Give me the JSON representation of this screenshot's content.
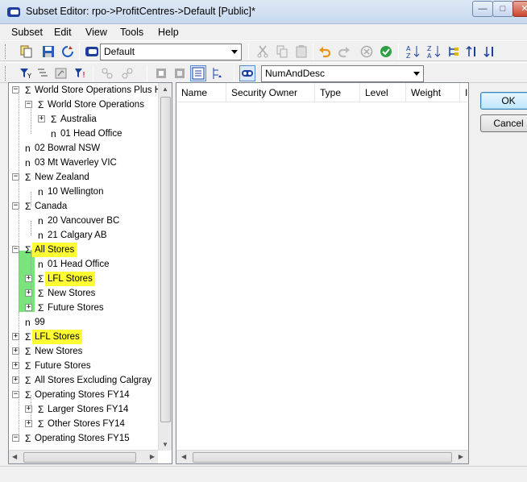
{
  "window": {
    "title": "Subset Editor:  rpo->ProfitCentres->Default  [Public]*",
    "minimize": "—",
    "maximize": "□",
    "close": "✕"
  },
  "menu": [
    "Subset",
    "Edit",
    "View",
    "Tools",
    "Help"
  ],
  "toolbar1": {
    "subset_name": "Default"
  },
  "toolbar2": {
    "alias_value": "NumAndDesc"
  },
  "tree": {
    "rows": [
      {
        "label": "World Store Operations Plus HC",
        "icon": "Σ",
        "exp": "−",
        "highlight": false
      },
      {
        "label": "World Store Operations",
        "icon": "Σ",
        "exp": "−",
        "highlight": false
      },
      {
        "label": "Australia",
        "icon": "Σ",
        "exp": "+",
        "highlight": false
      },
      {
        "label": "01 Head Office",
        "icon": "n",
        "exp": "",
        "highlight": false
      },
      {
        "label": "02 Bowral NSW",
        "icon": "n",
        "exp": "",
        "highlight": false
      },
      {
        "label": "03 Mt Waverley VIC",
        "icon": "n",
        "exp": "",
        "highlight": false
      },
      {
        "label": "New Zealand",
        "icon": "Σ",
        "exp": "−",
        "highlight": false
      },
      {
        "label": "10 Wellington",
        "icon": "n",
        "exp": "",
        "highlight": false
      },
      {
        "label": "Canada",
        "icon": "Σ",
        "exp": "−",
        "highlight": false
      },
      {
        "label": "20 Vancouver BC",
        "icon": "n",
        "exp": "",
        "highlight": false
      },
      {
        "label": "21 Calgary AB",
        "icon": "n",
        "exp": "",
        "highlight": false
      },
      {
        "label": "All Stores",
        "icon": "Σ",
        "exp": "−",
        "highlight": true
      },
      {
        "label": "01 Head Office",
        "icon": "n",
        "exp": "",
        "highlight": false
      },
      {
        "label": "LFL Stores",
        "icon": "Σ",
        "exp": "+",
        "highlight": true
      },
      {
        "label": "New Stores",
        "icon": "Σ",
        "exp": "+",
        "highlight": false
      },
      {
        "label": "Future Stores",
        "icon": "Σ",
        "exp": "+",
        "highlight": false
      },
      {
        "label": "99",
        "icon": "n",
        "exp": "",
        "highlight": false
      },
      {
        "label": "LFL Stores",
        "icon": "Σ",
        "exp": "+",
        "highlight": true
      },
      {
        "label": "New Stores",
        "icon": "Σ",
        "exp": "+",
        "highlight": false
      },
      {
        "label": "Future Stores",
        "icon": "Σ",
        "exp": "+",
        "highlight": false
      },
      {
        "label": "All Stores Excluding Calgray",
        "icon": "Σ",
        "exp": "+",
        "highlight": false
      },
      {
        "label": "Operating Stores FY14",
        "icon": "Σ",
        "exp": "−",
        "highlight": false
      },
      {
        "label": "Larger Stores FY14",
        "icon": "Σ",
        "exp": "+",
        "highlight": false
      },
      {
        "label": "Other Stores FY14",
        "icon": "Σ",
        "exp": "+",
        "highlight": false
      },
      {
        "label": "Operating Stores FY15",
        "icon": "Σ",
        "exp": "−",
        "highlight": false
      }
    ]
  },
  "columns": [
    "Name",
    "Security Owner",
    "Type",
    "Level",
    "Weight",
    "I"
  ],
  "buttons": {
    "ok": "OK",
    "cancel": "Cancel"
  },
  "colors": {
    "highlight": "#ffff33",
    "green_band": "#7be37b"
  }
}
